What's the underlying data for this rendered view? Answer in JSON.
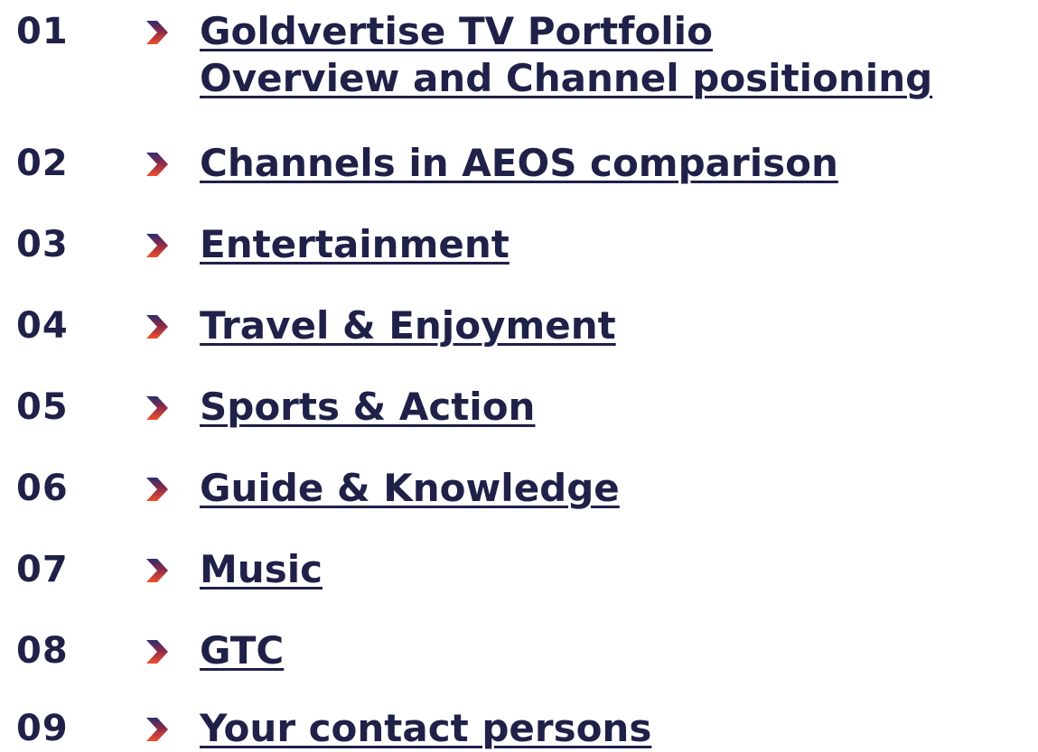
{
  "toc": {
    "items": [
      {
        "number": "01",
        "title": "Goldvertise TV Portfolio",
        "subtitle": "Overview and Channel positioning"
      },
      {
        "number": "02",
        "title": "Channels in AEOS comparison"
      },
      {
        "number": "03",
        "title": "Entertainment"
      },
      {
        "number": "04",
        "title": "Travel & Enjoyment"
      },
      {
        "number": "05",
        "title": "Sports & Action"
      },
      {
        "number": "06",
        "title": "Guide & Knowledge"
      },
      {
        "number": "07",
        "title": "Music"
      },
      {
        "number": "08",
        "title": "GTC"
      },
      {
        "number": "09",
        "title": "Your contact persons"
      }
    ]
  },
  "colors": {
    "text": "#1f2148",
    "arrow_top": "#2b2f6e",
    "arrow_bottom": "#e8472a"
  },
  "icons": {
    "bullet": "chevron-right-icon"
  }
}
